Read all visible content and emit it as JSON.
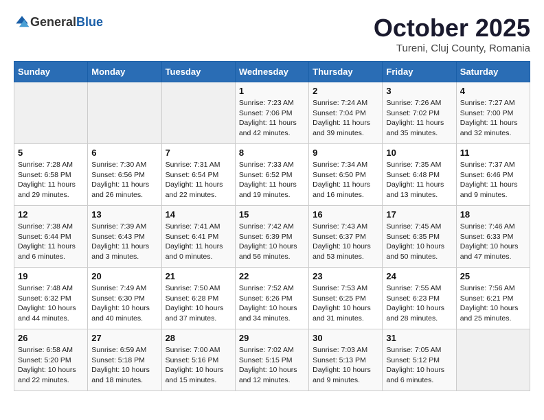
{
  "header": {
    "logo_general": "General",
    "logo_blue": "Blue",
    "month_title": "October 2025",
    "location": "Tureni, Cluj County, Romania"
  },
  "weekdays": [
    "Sunday",
    "Monday",
    "Tuesday",
    "Wednesday",
    "Thursday",
    "Friday",
    "Saturday"
  ],
  "weeks": [
    [
      {
        "day": "",
        "info": ""
      },
      {
        "day": "",
        "info": ""
      },
      {
        "day": "",
        "info": ""
      },
      {
        "day": "1",
        "info": "Sunrise: 7:23 AM\nSunset: 7:06 PM\nDaylight: 11 hours\nand 42 minutes."
      },
      {
        "day": "2",
        "info": "Sunrise: 7:24 AM\nSunset: 7:04 PM\nDaylight: 11 hours\nand 39 minutes."
      },
      {
        "day": "3",
        "info": "Sunrise: 7:26 AM\nSunset: 7:02 PM\nDaylight: 11 hours\nand 35 minutes."
      },
      {
        "day": "4",
        "info": "Sunrise: 7:27 AM\nSunset: 7:00 PM\nDaylight: 11 hours\nand 32 minutes."
      }
    ],
    [
      {
        "day": "5",
        "info": "Sunrise: 7:28 AM\nSunset: 6:58 PM\nDaylight: 11 hours\nand 29 minutes."
      },
      {
        "day": "6",
        "info": "Sunrise: 7:30 AM\nSunset: 6:56 PM\nDaylight: 11 hours\nand 26 minutes."
      },
      {
        "day": "7",
        "info": "Sunrise: 7:31 AM\nSunset: 6:54 PM\nDaylight: 11 hours\nand 22 minutes."
      },
      {
        "day": "8",
        "info": "Sunrise: 7:33 AM\nSunset: 6:52 PM\nDaylight: 11 hours\nand 19 minutes."
      },
      {
        "day": "9",
        "info": "Sunrise: 7:34 AM\nSunset: 6:50 PM\nDaylight: 11 hours\nand 16 minutes."
      },
      {
        "day": "10",
        "info": "Sunrise: 7:35 AM\nSunset: 6:48 PM\nDaylight: 11 hours\nand 13 minutes."
      },
      {
        "day": "11",
        "info": "Sunrise: 7:37 AM\nSunset: 6:46 PM\nDaylight: 11 hours\nand 9 minutes."
      }
    ],
    [
      {
        "day": "12",
        "info": "Sunrise: 7:38 AM\nSunset: 6:44 PM\nDaylight: 11 hours\nand 6 minutes."
      },
      {
        "day": "13",
        "info": "Sunrise: 7:39 AM\nSunset: 6:43 PM\nDaylight: 11 hours\nand 3 minutes."
      },
      {
        "day": "14",
        "info": "Sunrise: 7:41 AM\nSunset: 6:41 PM\nDaylight: 11 hours\nand 0 minutes."
      },
      {
        "day": "15",
        "info": "Sunrise: 7:42 AM\nSunset: 6:39 PM\nDaylight: 10 hours\nand 56 minutes."
      },
      {
        "day": "16",
        "info": "Sunrise: 7:43 AM\nSunset: 6:37 PM\nDaylight: 10 hours\nand 53 minutes."
      },
      {
        "day": "17",
        "info": "Sunrise: 7:45 AM\nSunset: 6:35 PM\nDaylight: 10 hours\nand 50 minutes."
      },
      {
        "day": "18",
        "info": "Sunrise: 7:46 AM\nSunset: 6:33 PM\nDaylight: 10 hours\nand 47 minutes."
      }
    ],
    [
      {
        "day": "19",
        "info": "Sunrise: 7:48 AM\nSunset: 6:32 PM\nDaylight: 10 hours\nand 44 minutes."
      },
      {
        "day": "20",
        "info": "Sunrise: 7:49 AM\nSunset: 6:30 PM\nDaylight: 10 hours\nand 40 minutes."
      },
      {
        "day": "21",
        "info": "Sunrise: 7:50 AM\nSunset: 6:28 PM\nDaylight: 10 hours\nand 37 minutes."
      },
      {
        "day": "22",
        "info": "Sunrise: 7:52 AM\nSunset: 6:26 PM\nDaylight: 10 hours\nand 34 minutes."
      },
      {
        "day": "23",
        "info": "Sunrise: 7:53 AM\nSunset: 6:25 PM\nDaylight: 10 hours\nand 31 minutes."
      },
      {
        "day": "24",
        "info": "Sunrise: 7:55 AM\nSunset: 6:23 PM\nDaylight: 10 hours\nand 28 minutes."
      },
      {
        "day": "25",
        "info": "Sunrise: 7:56 AM\nSunset: 6:21 PM\nDaylight: 10 hours\nand 25 minutes."
      }
    ],
    [
      {
        "day": "26",
        "info": "Sunrise: 6:58 AM\nSunset: 5:20 PM\nDaylight: 10 hours\nand 22 minutes."
      },
      {
        "day": "27",
        "info": "Sunrise: 6:59 AM\nSunset: 5:18 PM\nDaylight: 10 hours\nand 18 minutes."
      },
      {
        "day": "28",
        "info": "Sunrise: 7:00 AM\nSunset: 5:16 PM\nDaylight: 10 hours\nand 15 minutes."
      },
      {
        "day": "29",
        "info": "Sunrise: 7:02 AM\nSunset: 5:15 PM\nDaylight: 10 hours\nand 12 minutes."
      },
      {
        "day": "30",
        "info": "Sunrise: 7:03 AM\nSunset: 5:13 PM\nDaylight: 10 hours\nand 9 minutes."
      },
      {
        "day": "31",
        "info": "Sunrise: 7:05 AM\nSunset: 5:12 PM\nDaylight: 10 hours\nand 6 minutes."
      },
      {
        "day": "",
        "info": ""
      }
    ]
  ]
}
